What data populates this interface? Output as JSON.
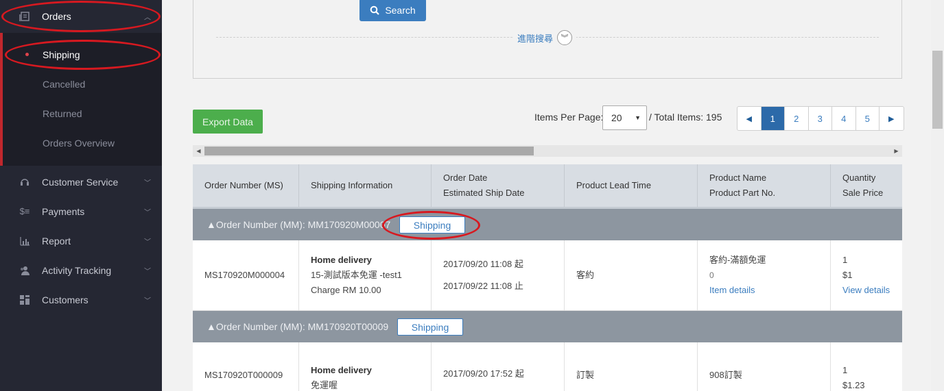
{
  "sidebar": {
    "orders_label": "Orders",
    "sub_items": [
      "Shipping",
      "Cancelled",
      "Returned",
      "Orders Overview"
    ],
    "items": [
      {
        "label": "Customer Service",
        "icon": "headset-icon"
      },
      {
        "label": "Payments",
        "icon": "dollar-icon"
      },
      {
        "label": "Report",
        "icon": "bar-chart-icon"
      },
      {
        "label": "Activity Tracking",
        "icon": "users-icon"
      },
      {
        "label": "Customers",
        "icon": "grid-icon"
      }
    ]
  },
  "search": {
    "button_label": "Search",
    "advanced_label": "進階搜尋"
  },
  "toolbar": {
    "export_label": "Export Data",
    "per_page_label": "Items Per Page:",
    "per_page_value": "20",
    "total_label": "/ Total Items: 195"
  },
  "pagination": {
    "pages": [
      "1",
      "2",
      "3",
      "4",
      "5"
    ],
    "active": "1"
  },
  "table": {
    "headers": [
      {
        "line1": "Order Number (MS)",
        "line2": ""
      },
      {
        "line1": "Shipping Information",
        "line2": ""
      },
      {
        "line1": "Order Date",
        "line2": "Estimated Ship Date"
      },
      {
        "line1": "Product Lead Time",
        "line2": ""
      },
      {
        "line1": "Product Name",
        "line2": "Product Part No."
      },
      {
        "line1": "Quantity",
        "line2": "Sale Price"
      }
    ],
    "groups": [
      {
        "label": "▲Order Number (MM): MM170920M000004",
        "visible_label": "▲Order Number (MM): MM170920M00007",
        "badge": "Shipping",
        "row": {
          "order_number": "MS170920M000004",
          "ship_method": "Home delivery",
          "ship_line2": "15-測試版本免運 -test1",
          "ship_line3": "Charge RM 10.00",
          "order_date": "2017/09/20 11:08 起",
          "ship_date": "2017/09/22 11:08 止",
          "lead_time": "客約",
          "product_name": "客約-滿額免運",
          "part_no": "0",
          "item_link": "Item details",
          "quantity": "1",
          "price": "$1",
          "view_link": "View details"
        }
      },
      {
        "label": "▲Order Number (MM): MM170920T00009",
        "badge": "Shipping",
        "row": {
          "order_number": "MS170920T000009",
          "ship_method": "Home delivery",
          "ship_line2": "免運喔",
          "order_date": "2017/09/20 17:52 起",
          "lead_time": "訂製",
          "product_name": "908訂製",
          "quantity": "1",
          "price": "$1.23"
        }
      }
    ]
  },
  "colors": {
    "sidebar_bg": "#252733",
    "accent_red": "#c1272d",
    "primary_blue": "#3b7dbf",
    "export_green": "#4cae4c",
    "group_row_bg": "#8d96a0"
  }
}
